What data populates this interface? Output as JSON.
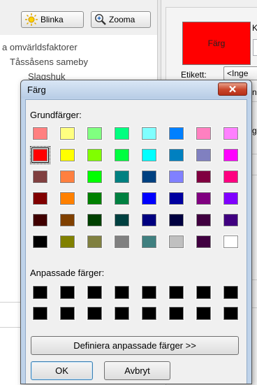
{
  "toolbar": {
    "blink_label": "Blinka",
    "zoom_label": "Zooma"
  },
  "tree": {
    "items": [
      "a omvärldsfaktorer",
      "Tåssåsens sameby",
      "Slagshuk"
    ]
  },
  "right_panel": {
    "color_preview_label": "Färg",
    "color_preview_color": "#ff0000",
    "k_fragment": "K",
    "label_caption": "Etikett:",
    "label_value": "<Inge",
    "fragment_1": "n:",
    "fragment_2": "g:"
  },
  "dialog": {
    "title": "Färg",
    "basic_colors_label": "Grundfärger:",
    "custom_colors_label": "Anpassade färger:",
    "define_button": "Definiera anpassade färger >>",
    "ok_button": "OK",
    "cancel_button": "Avbryt",
    "selected_color": "#ff0000",
    "basic_colors": [
      [
        "#ff8080",
        "#ffff80",
        "#80ff80",
        "#00ff80",
        "#80ffff",
        "#0080ff",
        "#ff80c0",
        "#ff80ff"
      ],
      [
        "#ff0000",
        "#ffff00",
        "#80ff00",
        "#00ff40",
        "#00ffff",
        "#0080c0",
        "#8080c0",
        "#ff00ff"
      ],
      [
        "#804040",
        "#ff8040",
        "#00ff00",
        "#008080",
        "#004080",
        "#8080ff",
        "#800040",
        "#ff0080"
      ],
      [
        "#800000",
        "#ff8000",
        "#008000",
        "#008040",
        "#0000ff",
        "#0000a0",
        "#800080",
        "#8000ff"
      ],
      [
        "#400000",
        "#804000",
        "#004000",
        "#004040",
        "#000080",
        "#000040",
        "#400040",
        "#400080"
      ],
      [
        "#000000",
        "#808000",
        "#808040",
        "#808080",
        "#408080",
        "#c0c0c0",
        "#400040",
        "#ffffff"
      ]
    ],
    "custom_colors": [
      [
        "#000000",
        "#000000",
        "#000000",
        "#000000",
        "#000000",
        "#000000",
        "#000000",
        "#000000"
      ],
      [
        "#000000",
        "#000000",
        "#000000",
        "#000000",
        "#000000",
        "#000000",
        "#000000",
        "#000000"
      ]
    ]
  }
}
